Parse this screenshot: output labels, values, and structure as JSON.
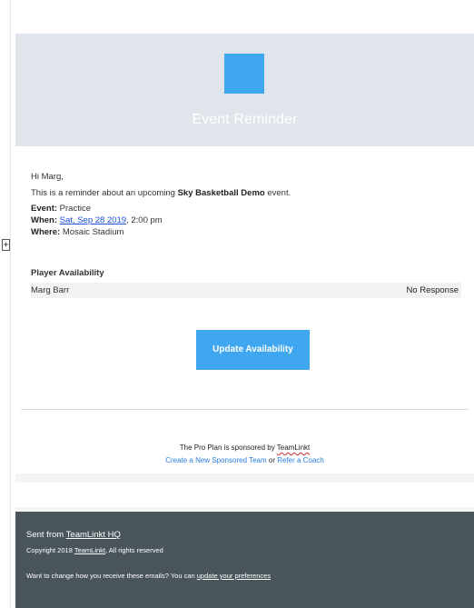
{
  "gutter": {
    "widget_glyph": "+"
  },
  "hero": {
    "title": "Event Reminder",
    "logo_color": "#3fa7ef",
    "background": "#dfe5ea"
  },
  "body": {
    "greeting": "Hi Marg,",
    "intro_prefix": "This is a reminder about an upcoming ",
    "team_name": "Sky Basketball Demo",
    "intro_suffix": " event.",
    "event_label": "Event:",
    "event_value": " Practice",
    "when_label": "When:",
    "when_date": "Sat, Sep 28 2019",
    "when_time": ", 2:00 pm",
    "where_label": "Where:",
    "where_value": " Mosaic Stadium"
  },
  "availability": {
    "heading": "Player Availability",
    "rows": [
      {
        "name": "Marg Barr",
        "status": "No Response"
      }
    ],
    "button_label": "Update Availability",
    "button_color": "#3fa7ef"
  },
  "sponsor": {
    "text": "The Pro Plan is sponsored by ",
    "brand": "TeamLinkt",
    "link_create": "Create a New Sponsored Team",
    "or_text": " or ",
    "link_refer": "Refer a Coach"
  },
  "footer": {
    "sent_prefix": "Sent from ",
    "sent_link": "TeamLinkt HQ",
    "copyright_prefix": "Copyright 2018 ",
    "copyright_brand": "TeamLinkt",
    "copyright_suffix": ", All rights reserved",
    "pref_text": "Want to change how you receive these emails? You can ",
    "pref_link": "update your preferences",
    "background": "#4a545b"
  }
}
